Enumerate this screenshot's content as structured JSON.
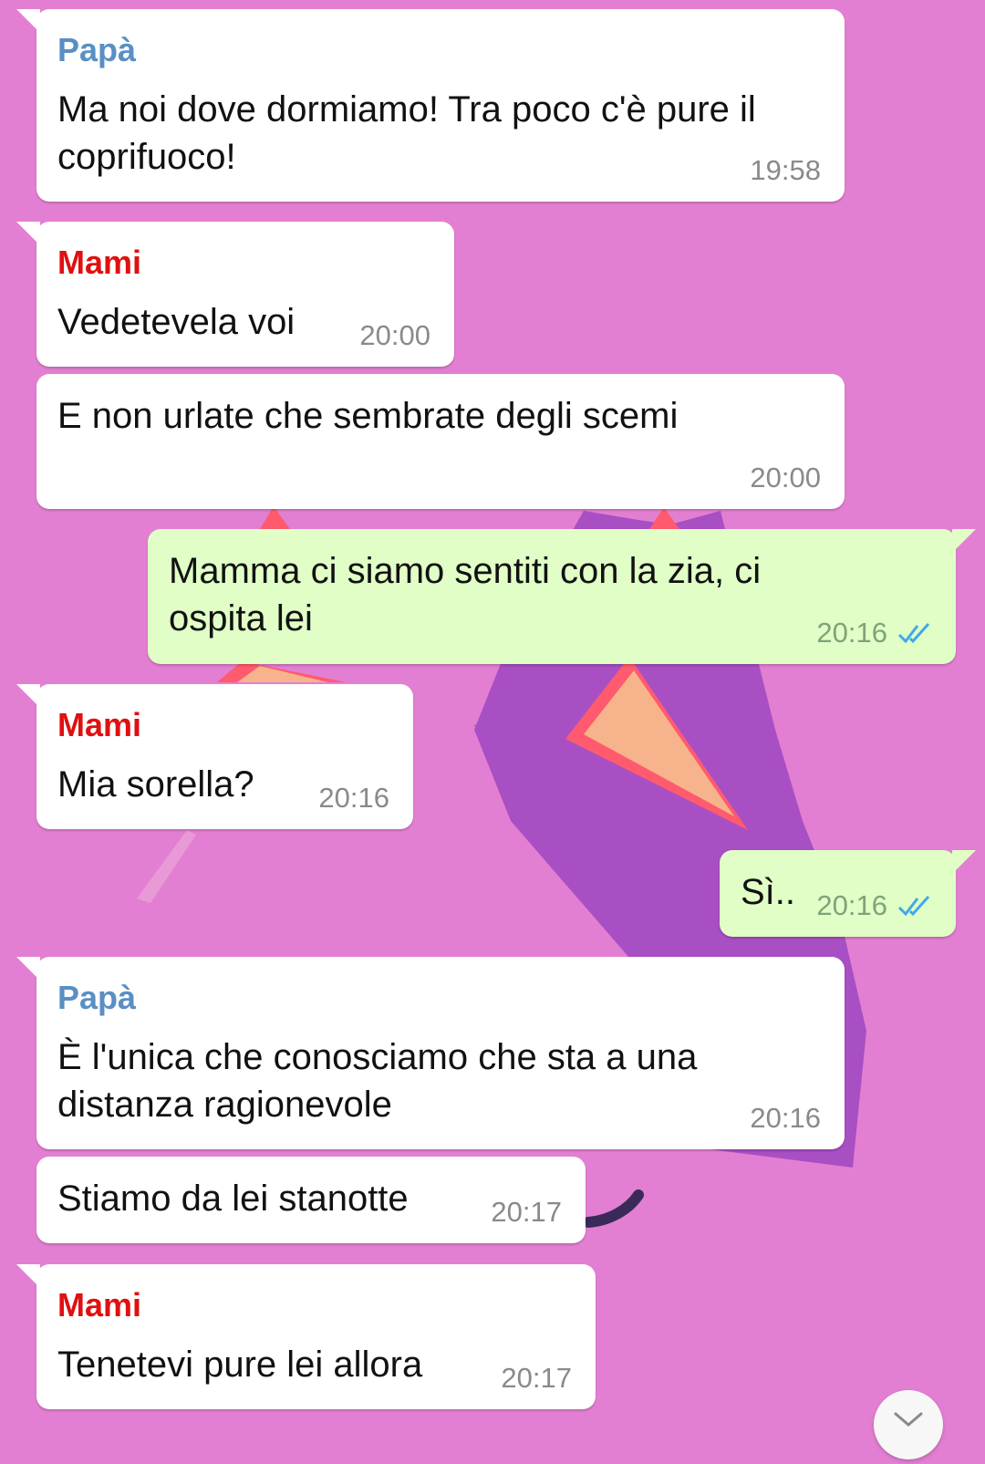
{
  "wallpaper": {
    "background": "#e37fd2",
    "shape_color": "#a94fc4",
    "ear_color": "#f7b38b",
    "ear_border": "#ff5a6e"
  },
  "messages": [
    {
      "sender": "Papà",
      "text": "Ma noi dove dormiamo! Tra poco c'è pure il\ncoprifuoco!",
      "time": "19:58"
    },
    {
      "sender": "Mami",
      "text": "Vedetevela voi",
      "time": "20:00"
    },
    {
      "text": "E non urlate che sembrate degli scemi",
      "time": "20:00"
    },
    {
      "text": "Mamma ci siamo sentiti con la zia, ci\nospita lei",
      "time": "20:16",
      "status": "read"
    },
    {
      "sender": "Mami",
      "text": "Mia sorella?",
      "time": "20:16"
    },
    {
      "text": "Sì..",
      "time": "20:16",
      "status": "read"
    },
    {
      "sender": "Papà",
      "text": "È l'unica che conosciamo che sta a una\ndistanza ragionevole",
      "time": "20:16"
    },
    {
      "text": "Stiamo da lei stanotte",
      "time": "20:17"
    },
    {
      "sender": "Mami",
      "text": "Tenetevi pure lei allora",
      "time": "20:17"
    }
  ],
  "icons": {
    "read_receipt": "double-check-icon",
    "scroll_down": "chevron-down-icon"
  }
}
